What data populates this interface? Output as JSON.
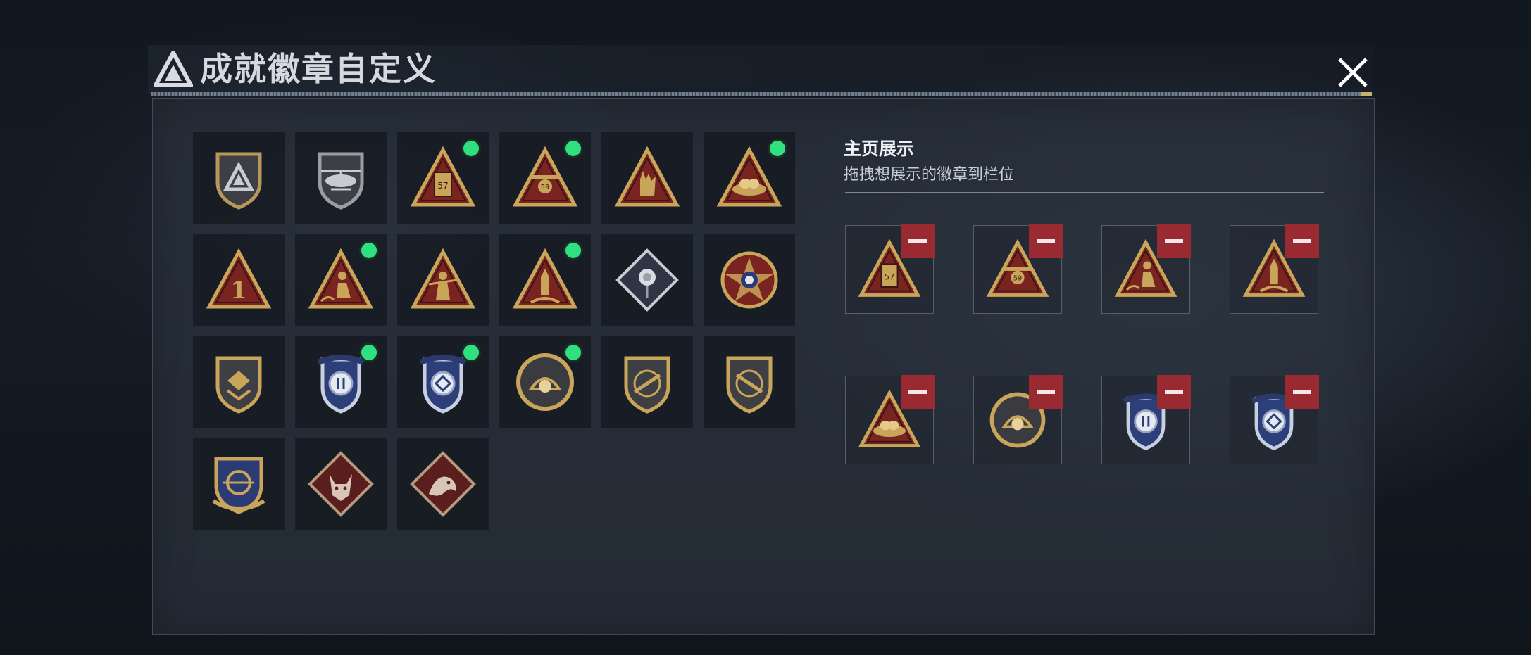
{
  "dialog": {
    "title": "成就徽章自定义",
    "close_icon": "close-icon"
  },
  "badges": [
    {
      "icon": "agency-shield-emblem-icon",
      "new": false
    },
    {
      "icon": "helicopter-badge-icon",
      "new": false
    },
    {
      "icon": "pager-57-badge-icon",
      "new": true
    },
    {
      "icon": "drone-59-badge-icon",
      "new": true
    },
    {
      "icon": "hand-sign-badge-icon",
      "new": false
    },
    {
      "icon": "egg-nest-badge-icon",
      "new": true
    },
    {
      "icon": "number-one-badge-icon",
      "new": false
    },
    {
      "icon": "sitting-figure-badge-icon",
      "new": true
    },
    {
      "icon": "soldier-badge-icon",
      "new": false
    },
    {
      "icon": "rocket-launch-badge-icon",
      "new": true
    },
    {
      "icon": "rose-diamond-badge-icon",
      "new": false
    },
    {
      "icon": "skull-star-medal-icon",
      "new": false
    },
    {
      "icon": "chevron-shield-badge-icon",
      "new": false
    },
    {
      "icon": "blue-wings-shield-a-icon",
      "new": true
    },
    {
      "icon": "blue-wings-shield-b-icon",
      "new": true
    },
    {
      "icon": "pearl-shell-coin-icon",
      "new": true
    },
    {
      "icon": "rifle-shield-a-icon",
      "new": false
    },
    {
      "icon": "rifle-shield-b-icon",
      "new": false
    },
    {
      "icon": "crosshair-crest-badge-icon",
      "new": false
    },
    {
      "icon": "wolf-diamond-badge-icon",
      "new": false
    },
    {
      "icon": "dragon-diamond-badge-icon",
      "new": false
    }
  ],
  "showcase": {
    "title": "主页展示",
    "subtitle": "拖拽想展示的徽章到栏位",
    "slots": [
      {
        "icon": "pager-57-badge-icon"
      },
      {
        "icon": "drone-59-badge-icon"
      },
      {
        "icon": "sitting-figure-badge-icon"
      },
      {
        "icon": "rocket-launch-badge-icon"
      },
      {
        "icon": "egg-nest-badge-icon"
      },
      {
        "icon": "pearl-shell-coin-icon"
      },
      {
        "icon": "blue-wings-shield-a-icon"
      },
      {
        "icon": "blue-wings-shield-b-icon"
      }
    ],
    "remove_icon": "minus-icon"
  },
  "badge_labels": {
    "pager": "57",
    "drone": "59",
    "number": "1"
  },
  "colors": {
    "gold": "#c9a55a",
    "crimson": "#7a2422",
    "navy": "#2d3f78",
    "new_dot": "#2ee07f",
    "remove_red": "#9a2a31"
  }
}
